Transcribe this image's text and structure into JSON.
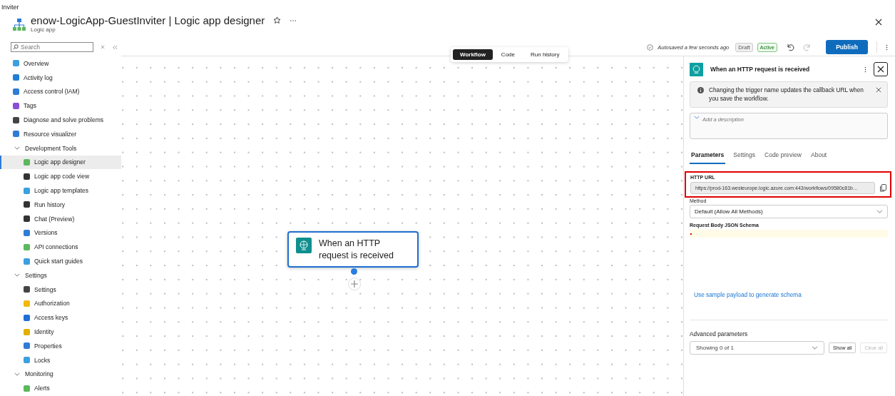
{
  "breadcrumb": "Inviter",
  "header": {
    "title": "enow-LogicApp-GuestInviter | Logic app designer",
    "subtitle": "Logic app"
  },
  "sidebar": {
    "search": {
      "placeholder": "Search"
    },
    "items": [
      {
        "kind": "item",
        "label": "Overview",
        "selected": false
      },
      {
        "kind": "item",
        "label": "Activity log",
        "selected": false
      },
      {
        "kind": "item",
        "label": "Access control (IAM)",
        "selected": false
      },
      {
        "kind": "item",
        "label": "Tags",
        "selected": false
      },
      {
        "kind": "item",
        "label": "Diagnose and solve problems",
        "selected": false
      },
      {
        "kind": "item",
        "label": "Resource visualizer",
        "selected": false
      },
      {
        "kind": "group",
        "label": "Development Tools",
        "expanded": true,
        "children": [
          {
            "label": "Logic app designer",
            "selected": true
          },
          {
            "label": "Logic app code view",
            "selected": false
          },
          {
            "label": "Logic app templates",
            "selected": false
          },
          {
            "label": "Run history",
            "selected": false
          },
          {
            "label": "Chat (Preview)",
            "selected": false
          },
          {
            "label": "Versions",
            "selected": false
          },
          {
            "label": "API connections",
            "selected": false
          },
          {
            "label": "Quick start guides",
            "selected": false
          }
        ]
      },
      {
        "kind": "group",
        "label": "Settings",
        "expanded": true,
        "children": [
          {
            "label": "Settings",
            "selected": false
          },
          {
            "label": "Authorization",
            "selected": false
          },
          {
            "label": "Access keys",
            "selected": false
          },
          {
            "label": "Identity",
            "selected": false
          },
          {
            "label": "Properties",
            "selected": false
          },
          {
            "label": "Locks",
            "selected": false
          }
        ]
      },
      {
        "kind": "group",
        "label": "Monitoring",
        "expanded": true,
        "children": [
          {
            "label": "Alerts",
            "selected": false
          }
        ]
      }
    ]
  },
  "view_tabs": [
    {
      "label": "Workflow",
      "selected": true
    },
    {
      "label": "Code",
      "selected": false
    },
    {
      "label": "Run history",
      "selected": false
    }
  ],
  "toolbar": {
    "autosave": "Autosaved a few seconds ago",
    "badges": [
      {
        "label": "Draft",
        "kind": "neutral"
      },
      {
        "label": "Active",
        "kind": "success"
      }
    ],
    "undo_disabled": false,
    "redo_disabled": true,
    "publish": "Publish"
  },
  "canvas": {
    "node": {
      "title": "When an HTTP request is received"
    }
  },
  "panel": {
    "title": "When an HTTP request is received",
    "info": "Changing the trigger name updates the callback URL when you save the workflow.",
    "description": {
      "placeholder": "Add a description"
    },
    "tabs": [
      {
        "label": "Parameters",
        "selected": true
      },
      {
        "label": "Settings",
        "selected": false
      },
      {
        "label": "Code preview",
        "selected": false
      },
      {
        "label": "About",
        "selected": false
      }
    ],
    "http_url": {
      "label": "HTTP URL",
      "value": "https://prod-163.westeurope.logic.azure.com:443/workflows/09580c81b…",
      "highlighted": true
    },
    "method": {
      "label": "Method",
      "value": "Default (Allow All Methods)"
    },
    "schema": {
      "label": "Request Body JSON Schema"
    },
    "link": "Use sample payload to generate schema",
    "advanced": {
      "label": "Advanced parameters",
      "value": "Showing 0 of 1",
      "show_all": "Show all",
      "clear_all": "Clear all",
      "clear_disabled": true
    }
  }
}
